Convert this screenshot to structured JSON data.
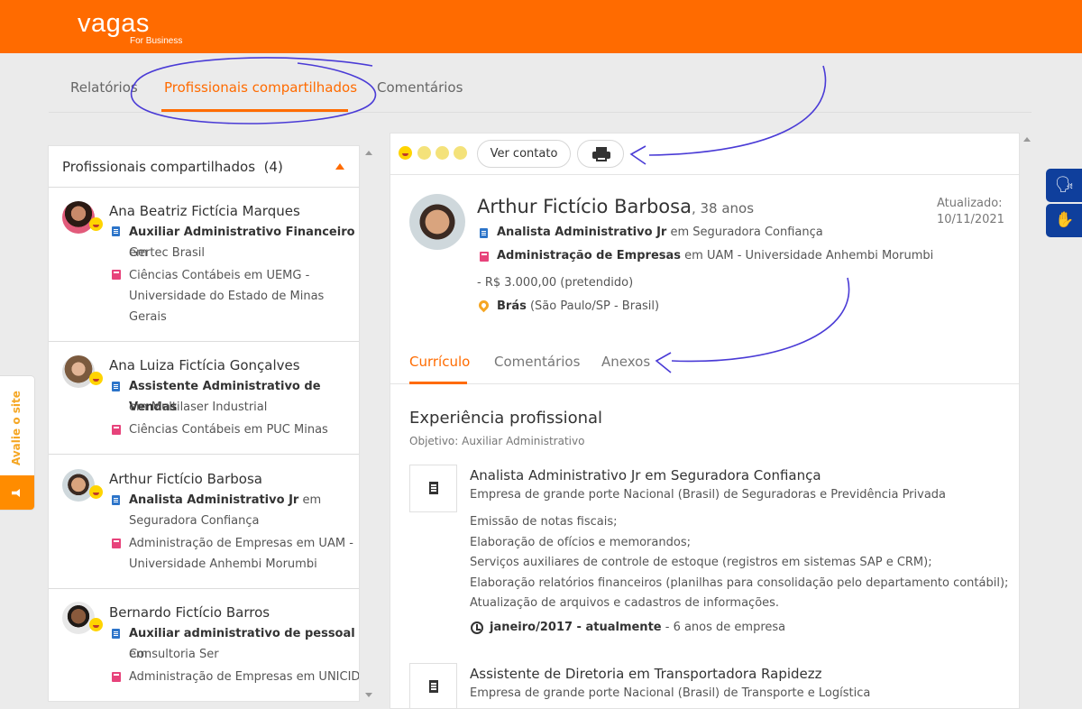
{
  "brand": {
    "logo_text": "vagas",
    "logo_sub": "For Business",
    "accent": "#ff6b00"
  },
  "top_tabs": {
    "reports": "Relatórios",
    "shared": "Profissionais compartilhados",
    "comments": "Comentários"
  },
  "sidebar": {
    "title": "Profissionais compartilhados",
    "count": "(4)",
    "candidates": [
      {
        "name": "Ana Beatriz Fictícia Marques",
        "job": "Auxiliar Administrativo Financeiro",
        "em": "em",
        "company": "Gertec Brasil",
        "education_1": "Ciências Contábeis em UEMG -",
        "education_2": "Universidade do Estado de Minas",
        "education_3": "Gerais"
      },
      {
        "name": "Ana Luiza Fictícia Gonçalves",
        "job": "Assistente Administrativo de Vendas",
        "company_line": "em Multilaser Industrial",
        "education_1": "Ciências Contábeis em PUC Minas"
      },
      {
        "name": "Arthur Fictício Barbosa",
        "job": "Analista Administrativo Jr",
        "em": "em",
        "company": "Seguradora Confiança",
        "education_1": "Administração de Empresas em UAM -",
        "education_2": "Universidade Anhembi Morumbi"
      },
      {
        "name": "Bernardo Fictício Barros",
        "job": "Auxiliar administrativo de pessoal",
        "em": "em",
        "company": "Consultoria Ser",
        "education_1": "Administração de Empresas em UNICID"
      }
    ]
  },
  "toolbar": {
    "contact_button": "Ver contato",
    "print_icon": "printer-icon"
  },
  "profile": {
    "name": "Arthur Fictício Barbosa",
    "age": ", 38 anos",
    "updated_label": "Atualizado:",
    "updated_date": "10/11/2021",
    "job": "Analista Administrativo Jr",
    "job_rest": " em Seguradora Confiança",
    "course": "Administração de Empresas",
    "course_rest": " em UAM - Universidade Anhembi Morumbi",
    "salary": "- R$ 3.000,00 (pretendido)",
    "location": "Brás",
    "location_rest": " (São Paulo/SP - Brasil)"
  },
  "main_tabs": {
    "resume": "Currículo",
    "comments": "Comentários",
    "attachments": "Anexos"
  },
  "experience": {
    "section_title": "Experiência profissional",
    "objective": "Objetivo: Auxiliar Administrativo",
    "items": [
      {
        "role": "Analista Administrativo Jr",
        "em": " em ",
        "company": "Seguradora Confiança",
        "desc": "Empresa de grande porte Nacional (Brasil) de Seguradoras e Previdência Privada",
        "tasks": [
          "Emissão de notas fiscais;",
          "Elaboração de ofícios e memorandos;",
          "Serviços auxiliares de controle de estoque (registros em sistemas SAP e CRM);",
          "Elaboração relatórios financeiros (planilhas para consolidação pelo departamento contábil);",
          "Atualização de arquivos e cadastros de informações."
        ],
        "period": "janeiro/2017 - atualmente",
        "duration": " - 6 anos de empresa"
      },
      {
        "role": "Assistente de Diretoria",
        "em": " em ",
        "company": "Transportadora Rapidezz",
        "desc": "Empresa de grande porte Nacional (Brasil) de Transporte e Logística"
      }
    ]
  },
  "feedback": {
    "label": "Avalie o site"
  }
}
